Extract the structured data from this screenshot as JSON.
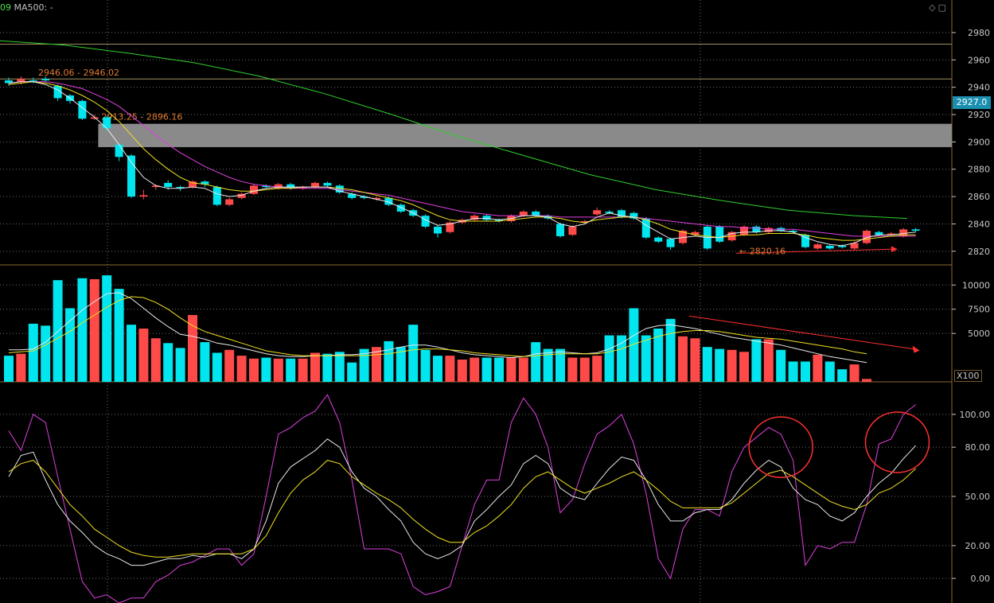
{
  "header": {
    "left_number": "09",
    "ma_label": "MA500: -"
  },
  "toolbar_icons": [
    "diamond-icon",
    "square-icon"
  ],
  "last_price_label": "2927.0",
  "volume_unit_label": "X100",
  "annotations": {
    "zone1_label": "2946.06 - 2946.02",
    "zone2_label": "2913.25 - 2896.16",
    "low_label": "2820.16"
  },
  "colors": {
    "up": "#ff4a4a",
    "down": "#00e5ee",
    "ma_fast": "#e8e8e8",
    "ma_mid": "#f0e020",
    "ma_slow": "#e040e0",
    "ma_long": "#30d030",
    "kdj_j": "#e040e0",
    "kdj_k": "#e8e8e8",
    "kdj_d": "#f0e020",
    "zone": "#8a8a8a",
    "arrow": "#ff3030",
    "grid": "#707070",
    "axis": "#c8c8c8",
    "level_line": "#a09060"
  },
  "chart_data": [
    {
      "type": "candlestick",
      "name": "price",
      "yaxis_ticks": [
        "2980",
        "2960",
        "2940",
        "2920",
        "2900",
        "2880",
        "2860",
        "2840",
        "2820"
      ],
      "ylim": [
        2810,
        2998
      ],
      "candles": [
        [
          2945,
          2943,
          2947,
          2941
        ],
        [
          2944,
          2946,
          2948,
          2942
        ],
        [
          2945,
          2944,
          2947,
          2943
        ],
        [
          2946,
          2945,
          2948,
          2944
        ],
        [
          2941,
          2932,
          2942,
          2930
        ],
        [
          2934,
          2930,
          2935,
          2928
        ],
        [
          2930,
          2917,
          2931,
          2916
        ],
        [
          2917,
          2918,
          2920,
          2916
        ],
        [
          2918,
          2910,
          2919,
          2908
        ],
        [
          2898,
          2889,
          2899,
          2886
        ],
        [
          2890,
          2860,
          2891,
          2859
        ],
        [
          2860,
          2861,
          2865,
          2858
        ],
        [
          2867,
          2868,
          2869,
          2865
        ],
        [
          2870,
          2867,
          2872,
          2865
        ],
        [
          2867,
          2866,
          2868,
          2864
        ],
        [
          2867,
          2871,
          2872,
          2866
        ],
        [
          2871,
          2869,
          2872,
          2867
        ],
        [
          2867,
          2854,
          2868,
          2853
        ],
        [
          2854,
          2858,
          2859,
          2853
        ],
        [
          2859,
          2862,
          2863,
          2858
        ],
        [
          2862,
          2868,
          2869,
          2861
        ],
        [
          2868,
          2867,
          2869,
          2866
        ],
        [
          2866,
          2869,
          2870,
          2865
        ],
        [
          2869,
          2866,
          2870,
          2865
        ],
        [
          2866,
          2867,
          2868,
          2865
        ],
        [
          2867,
          2870,
          2871,
          2866
        ],
        [
          2870,
          2868,
          2871,
          2867
        ],
        [
          2868,
          2863,
          2869,
          2862
        ],
        [
          2862,
          2859,
          2863,
          2858
        ],
        [
          2860,
          2859,
          2861,
          2858
        ],
        [
          2858,
          2859,
          2860,
          2857
        ],
        [
          2859,
          2854,
          2860,
          2853
        ],
        [
          2854,
          2849,
          2855,
          2848
        ],
        [
          2850,
          2846,
          2851,
          2845
        ],
        [
          2846,
          2838,
          2847,
          2837
        ],
        [
          2838,
          2833,
          2839,
          2830
        ],
        [
          2834,
          2841,
          2842,
          2833
        ],
        [
          2841,
          2843,
          2844,
          2840
        ],
        [
          2843,
          2846,
          2847,
          2842
        ],
        [
          2846,
          2843,
          2847,
          2842
        ],
        [
          2843,
          2842,
          2844,
          2841
        ],
        [
          2842,
          2846,
          2847,
          2841
        ],
        [
          2846,
          2849,
          2850,
          2845
        ],
        [
          2849,
          2846,
          2850,
          2845
        ],
        [
          2846,
          2844,
          2847,
          2843
        ],
        [
          2840,
          2831,
          2841,
          2830
        ],
        [
          2832,
          2838,
          2839,
          2831
        ],
        [
          2841,
          2842,
          2843,
          2840
        ],
        [
          2847,
          2850,
          2852,
          2846
        ],
        [
          2849,
          2848,
          2850,
          2847
        ],
        [
          2850,
          2845,
          2851,
          2844
        ],
        [
          2848,
          2844,
          2849,
          2843
        ],
        [
          2844,
          2830,
          2845,
          2829
        ],
        [
          2830,
          2827,
          2831,
          2826
        ],
        [
          2829,
          2823,
          2830,
          2821
        ],
        [
          2826,
          2835,
          2836,
          2825
        ],
        [
          2832,
          2834,
          2835,
          2831
        ],
        [
          2838,
          2822,
          2839,
          2821
        ],
        [
          2838,
          2827,
          2839,
          2826
        ],
        [
          2828,
          2834,
          2835,
          2827
        ],
        [
          2832,
          2838,
          2839,
          2831
        ],
        [
          2838,
          2834,
          2839,
          2833
        ],
        [
          2834,
          2837,
          2838,
          2833
        ],
        [
          2837,
          2835,
          2838,
          2834
        ],
        [
          2835,
          2834,
          2836,
          2833
        ],
        [
          2832,
          2823,
          2833,
          2822
        ],
        [
          2822,
          2825,
          2826,
          2821
        ],
        [
          2824,
          2822,
          2825,
          2821
        ],
        [
          2824,
          2823,
          2825,
          2822
        ],
        [
          2822,
          2826,
          2827,
          2821
        ],
        [
          2826,
          2835,
          2836,
          2825
        ],
        [
          2834,
          2832,
          2835,
          2831
        ],
        [
          2832,
          2833,
          2834,
          2831
        ],
        [
          2831,
          2836,
          2837,
          2830
        ],
        [
          2836,
          2835,
          2837,
          2834
        ]
      ],
      "ma_fast": [
        2943,
        2944,
        2944,
        2942,
        2938,
        2932,
        2925,
        2918,
        2910,
        2898,
        2885,
        2874,
        2868,
        2866,
        2866,
        2867,
        2866,
        2862,
        2860,
        2861,
        2864,
        2866,
        2867,
        2867,
        2867,
        2867,
        2867,
        2864,
        2862,
        2860,
        2858,
        2856,
        2852,
        2848,
        2843,
        2839,
        2840,
        2842,
        2844,
        2844,
        2843,
        2844,
        2846,
        2846,
        2845,
        2840,
        2838,
        2840,
        2845,
        2848,
        2846,
        2845,
        2839,
        2834,
        2829,
        2830,
        2831,
        2830,
        2830,
        2833,
        2834,
        2834,
        2835,
        2835,
        2834,
        2830,
        2827,
        2825,
        2824,
        2826,
        2830,
        2832,
        2832,
        2833,
        2834
      ],
      "ma_mid": [
        2942,
        2943,
        2944,
        2943,
        2941,
        2938,
        2934,
        2929,
        2923,
        2915,
        2905,
        2895,
        2887,
        2880,
        2874,
        2870,
        2869,
        2867,
        2865,
        2864,
        2864,
        2865,
        2866,
        2866,
        2867,
        2867,
        2867,
        2866,
        2865,
        2863,
        2861,
        2859,
        2857,
        2854,
        2850,
        2846,
        2843,
        2842,
        2842,
        2842,
        2842,
        2843,
        2844,
        2845,
        2845,
        2844,
        2842,
        2841,
        2843,
        2844,
        2845,
        2845,
        2843,
        2840,
        2836,
        2834,
        2832,
        2831,
        2830,
        2831,
        2832,
        2832,
        2833,
        2833,
        2833,
        2832,
        2830,
        2829,
        2828,
        2828,
        2829,
        2830,
        2831,
        2832,
        2832
      ],
      "ma_slow": [
        2943,
        2944,
        2944,
        2944,
        2943,
        2941,
        2939,
        2935,
        2931,
        2926,
        2919,
        2912,
        2905,
        2898,
        2892,
        2887,
        2882,
        2878,
        2874,
        2871,
        2869,
        2868,
        2867,
        2866,
        2866,
        2866,
        2866,
        2865,
        2864,
        2863,
        2862,
        2861,
        2859,
        2857,
        2855,
        2853,
        2851,
        2849,
        2848,
        2847,
        2846,
        2846,
        2846,
        2846,
        2846,
        2845,
        2845,
        2845,
        2845,
        2845,
        2845,
        2845,
        2844,
        2843,
        2842,
        2841,
        2840,
        2839,
        2838,
        2838,
        2837,
        2837,
        2836,
        2836,
        2836,
        2835,
        2834,
        2833,
        2832,
        2831,
        2831,
        2831,
        2831,
        2831,
        2831
      ],
      "ma_long_line": [
        [
          -1,
          2974
        ],
        [
          8,
          2971
        ],
        [
          18,
          2965
        ],
        [
          28,
          2958
        ],
        [
          38,
          2948
        ],
        [
          48,
          2935
        ],
        [
          58,
          2920
        ],
        [
          68,
          2904
        ],
        [
          78,
          2890
        ],
        [
          88,
          2876
        ],
        [
          98,
          2865
        ],
        [
          108,
          2857
        ],
        [
          118,
          2850
        ],
        [
          128,
          2846
        ],
        [
          136,
          2844
        ]
      ],
      "zones": [
        {
          "top": 2913.25,
          "bottom": 2896.16,
          "from_index": 7.3,
          "label_key": "zone2_label"
        }
      ],
      "level_lines": [
        2971.5,
        2946.06
      ],
      "low_marker": {
        "index": 60,
        "value": 2820.16,
        "arrow_to_index": 72,
        "arrow_value": 2821.5
      }
    },
    {
      "type": "bar",
      "name": "volume",
      "yaxis_ticks": [
        "10000",
        "7500",
        "5000"
      ],
      "ylim": [
        0,
        11500
      ],
      "values": [
        2700,
        2900,
        6000,
        5800,
        10500,
        7600,
        10700,
        10600,
        11000,
        9600,
        5900,
        5500,
        4500,
        4000,
        3500,
        6900,
        4100,
        3000,
        3300,
        2700,
        2400,
        2500,
        2400,
        2400,
        2400,
        3000,
        2900,
        3100,
        2000,
        3400,
        3600,
        4200,
        3600,
        5900,
        3300,
        2700,
        2700,
        2300,
        2500,
        2500,
        2500,
        2500,
        2500,
        4100,
        3400,
        3400,
        2500,
        2500,
        2700,
        4800,
        4800,
        7600,
        4800,
        5500,
        6500,
        4700,
        4500,
        3600,
        3400,
        3300,
        3100,
        4400,
        4400,
        3300,
        2100,
        2100,
        2800,
        2100,
        1300,
        1800,
        300
      ],
      "ma_yellow": [
        3000,
        3100,
        3200,
        3800,
        4500,
        5200,
        6100,
        6900,
        7700,
        8400,
        8800,
        8700,
        8200,
        7500,
        6600,
        5800,
        5200,
        4800,
        4400,
        4000,
        3600,
        3200,
        3000,
        2800,
        2700,
        2700,
        2700,
        2700,
        2700,
        2700,
        2800,
        2900,
        3100,
        3300,
        3400,
        3400,
        3300,
        3200,
        3000,
        2900,
        2800,
        2700,
        2600,
        2700,
        2800,
        2900,
        2900,
        2900,
        2900,
        3100,
        3400,
        3900,
        4300,
        4700,
        5000,
        5200,
        5300,
        5300,
        5200,
        5000,
        4800,
        4600,
        4500,
        4400,
        4200,
        4000,
        3800,
        3600,
        3400,
        3100,
        2900
      ],
      "ma_white": [
        3300,
        3300,
        3400,
        4100,
        5200,
        6300,
        7400,
        8300,
        9100,
        9200,
        8600,
        7600,
        6600,
        5700,
        4900,
        4700,
        4400,
        4000,
        3800,
        3500,
        3200,
        2900,
        2700,
        2600,
        2600,
        2700,
        2700,
        2800,
        2800,
        2900,
        3100,
        3300,
        3600,
        3800,
        3800,
        3600,
        3300,
        3000,
        2800,
        2700,
        2600,
        2500,
        2600,
        2900,
        3000,
        3100,
        3000,
        2900,
        3000,
        3400,
        4000,
        4800,
        5500,
        5800,
        5900,
        5700,
        5500,
        5200,
        4900,
        4600,
        4400,
        4200,
        4000,
        3800,
        3500,
        3200,
        2900,
        2600,
        2400,
        2200,
        2000
      ],
      "trend_arrow": {
        "from_index": 55.5,
        "from_value": 6800,
        "to_index": 73.8,
        "to_value": 3400
      }
    },
    {
      "type": "line",
      "name": "KDJ",
      "yaxis_ticks": [
        "100.00",
        "80.00",
        "50.00",
        "20.00",
        "0.00"
      ],
      "ylim": [
        -15,
        115
      ],
      "series": [
        {
          "key": "J",
          "values": [
            90,
            78,
            100,
            95,
            62,
            30,
            -2,
            -12,
            -10,
            -15,
            -12,
            -12,
            -2,
            2,
            8,
            10,
            14,
            18,
            18,
            8,
            15,
            50,
            88,
            92,
            98,
            102,
            112,
            95,
            60,
            18,
            18,
            18,
            15,
            -5,
            -10,
            -8,
            -5,
            20,
            45,
            60,
            60,
            95,
            110,
            100,
            80,
            40,
            48,
            70,
            88,
            93,
            100,
            82,
            52,
            12,
            0,
            30,
            42,
            42,
            38,
            65,
            80,
            86,
            92,
            88,
            72,
            8,
            20,
            18,
            22,
            22,
            45,
            82,
            85,
            100,
            106
          ]
        },
        {
          "key": "K",
          "values": [
            62,
            75,
            77,
            60,
            45,
            35,
            28,
            20,
            15,
            12,
            8,
            8,
            10,
            12,
            12,
            14,
            13,
            15,
            15,
            12,
            18,
            35,
            58,
            68,
            73,
            78,
            85,
            80,
            65,
            55,
            50,
            42,
            35,
            22,
            15,
            12,
            15,
            20,
            35,
            42,
            50,
            57,
            70,
            75,
            70,
            55,
            50,
            48,
            58,
            67,
            74,
            72,
            60,
            45,
            35,
            35,
            40,
            42,
            42,
            48,
            58,
            66,
            72,
            68,
            55,
            48,
            45,
            38,
            35,
            40,
            50,
            58,
            64,
            73,
            81
          ]
        },
        {
          "key": "D",
          "values": [
            65,
            70,
            72,
            65,
            55,
            45,
            38,
            30,
            25,
            20,
            16,
            14,
            13,
            13,
            14,
            15,
            15,
            15,
            15,
            15,
            18,
            26,
            40,
            52,
            60,
            65,
            72,
            70,
            62,
            57,
            52,
            48,
            43,
            36,
            30,
            25,
            22,
            22,
            28,
            32,
            38,
            45,
            55,
            62,
            65,
            60,
            55,
            52,
            55,
            58,
            62,
            65,
            60,
            54,
            47,
            43,
            43,
            43,
            43,
            46,
            52,
            58,
            64,
            66,
            62,
            57,
            52,
            47,
            44,
            42,
            45,
            52,
            55,
            60,
            67
          ]
        }
      ],
      "circles": [
        {
          "index": 63,
          "value": 80
        },
        {
          "index": 72.5,
          "value": 83
        }
      ]
    }
  ]
}
